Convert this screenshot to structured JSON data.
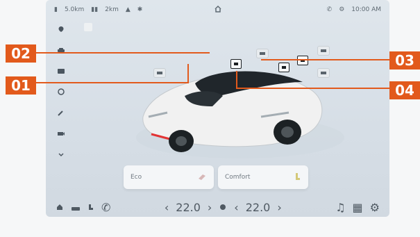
{
  "callouts": {
    "c01": "01",
    "c02": "02",
    "c03": "03",
    "c04": "04"
  },
  "status_bar": {
    "left_text_1": "5.0km",
    "left_text_2": "2km",
    "right_time": "10:00 AM"
  },
  "temps": {
    "left": "22.0",
    "right": "22.0"
  },
  "cards": [
    {
      "label": "Eco"
    },
    {
      "label": "Comfort"
    }
  ],
  "colors": {
    "callout": "#e25a1c",
    "screen_bg": "#dfe6ec",
    "car_body": "#f1f1f1",
    "car_roof": "#20262b",
    "accent_red": "#e33434"
  },
  "icons": {
    "status_left": [
      "signal-icon",
      "bars-icon",
      "wifi-icon",
      "sun-icon"
    ],
    "status_center": "home-icon",
    "status_right": [
      "phone-icon",
      "gear-icon"
    ],
    "sidebar": [
      "location-icon",
      "car-icon",
      "window-icon",
      "ac-icon",
      "wrench-icon",
      "camera-icon",
      "down-icon"
    ],
    "bottom_left": [
      "home-icon",
      "car-icon",
      "seat-icon",
      "phone-icon"
    ],
    "bottom_right": [
      "fan-icon",
      "music-icon",
      "grid-icon",
      "gear-icon"
    ]
  }
}
